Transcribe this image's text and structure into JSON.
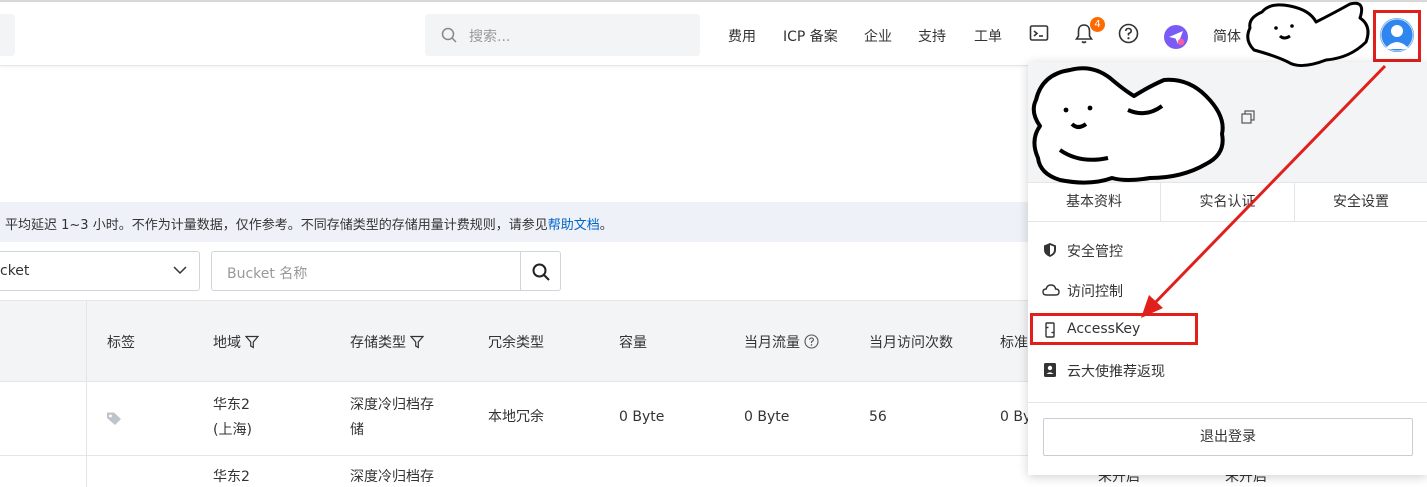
{
  "header": {
    "search_placeholder": "搜索...",
    "nav": [
      "费用",
      "ICP 备案",
      "企业",
      "支持",
      "工单"
    ],
    "notification_count": "4",
    "language": "简体"
  },
  "storage": {
    "info_text": "平均延迟 1~3 小时。不作为计量数据，仅作参考。不同存储类型的存储用量计费规则，请参见",
    "info_link": "帮助文档",
    "info_end": "。",
    "select_value": "cket",
    "bucket_placeholder": "Bucket 名称",
    "columns": [
      "标签",
      "地域",
      "存储类型",
      "冗余类型",
      "容量",
      "当月流量",
      "当月访问次数",
      "标准"
    ],
    "rows": [
      {
        "region_line1": "华东2",
        "region_line2": "(上海)",
        "storage_line1": "深度冷归档存",
        "storage_line2": "储",
        "redundancy": "本地冗余",
        "capacity": "0 Byte",
        "traffic": "0 Byte",
        "visits": "56",
        "standard": "0 By"
      },
      {
        "region_line1": "华东2",
        "storage_line1": "深度冷归档存"
      }
    ],
    "behind_menu": [
      "未开启",
      "未开启"
    ]
  },
  "user_menu": {
    "tabs": [
      "基本资料",
      "实名认证",
      "安全设置"
    ],
    "items": [
      "安全管控",
      "访问控制",
      "AccessKey",
      "云大使推荐返现"
    ],
    "logout": "退出登录"
  },
  "colors": {
    "accent": "#ff6a00",
    "link": "#0064c8",
    "highlight": "#e0201c",
    "avatar": "#2f86ee"
  }
}
